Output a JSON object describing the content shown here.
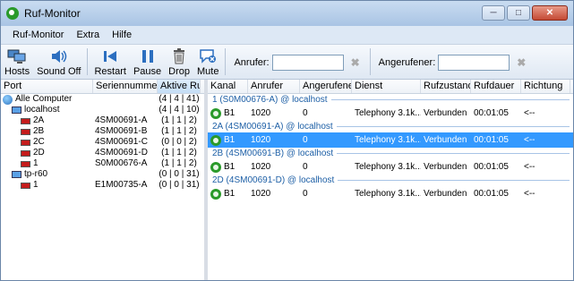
{
  "window": {
    "title": "Ruf-Monitor"
  },
  "menu": [
    "Ruf-Monitor",
    "Extra",
    "Hilfe"
  ],
  "toolbar": {
    "buttons": [
      {
        "label": "Hosts"
      },
      {
        "label": "Sound Off"
      },
      {
        "label": "Restart"
      },
      {
        "label": "Pause"
      },
      {
        "label": "Drop"
      },
      {
        "label": "Mute"
      }
    ],
    "caller_label": "Anrufer:",
    "callee_label": "Angerufener:",
    "caller_value": "",
    "callee_value": ""
  },
  "tree": {
    "headers": [
      "Port",
      "Seriennummer",
      "Aktive Rufe"
    ],
    "rows": [
      {
        "port": "Alle Computer",
        "serial": "",
        "active": "(4 | 4 | 41)",
        "icon": "globe-icon",
        "indent": 0
      },
      {
        "port": "localhost",
        "serial": "",
        "active": "(4 | 4 | 10)",
        "icon": "computer-icon",
        "indent": 1
      },
      {
        "port": "2A",
        "serial": "4SM00691-A",
        "active": "(1 | 1 | 2)",
        "icon": "port-icon",
        "indent": 2
      },
      {
        "port": "2B",
        "serial": "4SM00691-B",
        "active": "(1 | 1 | 2)",
        "icon": "port-icon",
        "indent": 2
      },
      {
        "port": "2C",
        "serial": "4SM00691-C",
        "active": "(0 | 0 | 2)",
        "icon": "port-icon",
        "indent": 2
      },
      {
        "port": "2D",
        "serial": "4SM00691-D",
        "active": "(1 | 1 | 2)",
        "icon": "port-icon",
        "indent": 2
      },
      {
        "port": "1",
        "serial": "S0M00676-A",
        "active": "(1 | 1 | 2)",
        "icon": "port-icon",
        "indent": 2
      },
      {
        "port": "tp-r60",
        "serial": "",
        "active": "(0 | 0 | 31)",
        "icon": "computer-icon",
        "indent": 1
      },
      {
        "port": "1",
        "serial": "E1M00735-A",
        "active": "(0 | 0 | 31)",
        "icon": "port-icon",
        "indent": 2
      }
    ]
  },
  "calls": {
    "headers": [
      "Kanal",
      "Anrufer",
      "Angerufener",
      "Dienst",
      "Rufzustand",
      "Rufdauer",
      "Richtung"
    ],
    "groups": [
      {
        "title": "1 (S0M00676-A) @ localhost",
        "rows": [
          {
            "kanal": "B1",
            "anrufer": "1020",
            "angerufener": "0",
            "dienst": "Telephony 3.1k...",
            "zustand": "Verbunden",
            "dauer": "00:01:05",
            "richtung": "<--",
            "selected": false
          }
        ]
      },
      {
        "title": "2A (4SM00691-A) @ localhost",
        "rows": [
          {
            "kanal": "B1",
            "anrufer": "1020",
            "angerufener": "0",
            "dienst": "Telephony 3.1k...",
            "zustand": "Verbunden",
            "dauer": "00:01:05",
            "richtung": "<--",
            "selected": true
          }
        ]
      },
      {
        "title": "2B (4SM00691-B) @ localhost",
        "rows": [
          {
            "kanal": "B1",
            "anrufer": "1020",
            "angerufener": "0",
            "dienst": "Telephony 3.1k...",
            "zustand": "Verbunden",
            "dauer": "00:01:05",
            "richtung": "<--",
            "selected": false
          }
        ]
      },
      {
        "title": "2D (4SM00691-D) @ localhost",
        "rows": [
          {
            "kanal": "B1",
            "anrufer": "1020",
            "angerufener": "0",
            "dienst": "Telephony 3.1k...",
            "zustand": "Verbunden",
            "dauer": "00:01:05",
            "richtung": "<--",
            "selected": false
          }
        ]
      }
    ]
  }
}
